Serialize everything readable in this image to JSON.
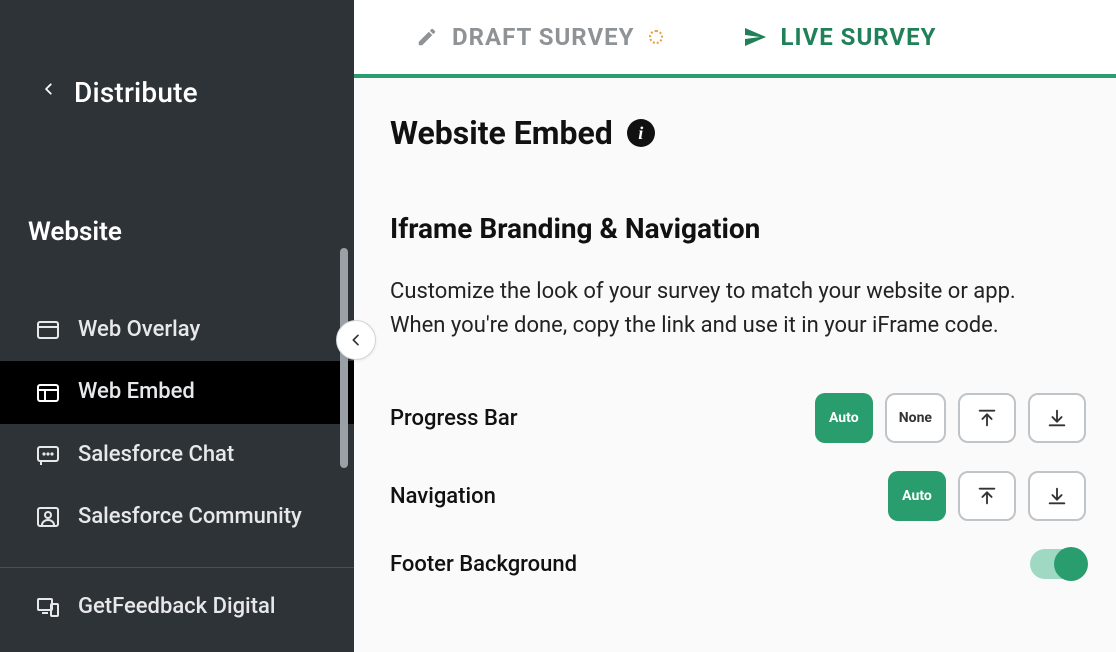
{
  "header": {
    "back_label": "Distribute"
  },
  "sidebar": {
    "section": "Website",
    "items": [
      {
        "label": "Web Overlay"
      },
      {
        "label": "Web Embed"
      },
      {
        "label": "Salesforce Chat"
      },
      {
        "label": "Salesforce Community"
      },
      {
        "label": "GetFeedback Digital"
      }
    ]
  },
  "tabs": {
    "draft": "DRAFT SURVEY",
    "live": "LIVE SURVEY"
  },
  "page": {
    "title": "Website Embed",
    "subsection": "Iframe Branding & Navigation",
    "description": "Customize the look of your survey to match your website or app. When you're done, copy the link and use it in your iFrame code."
  },
  "options": {
    "progress_bar": {
      "label": "Progress Bar",
      "auto": "Auto",
      "none": "None"
    },
    "navigation": {
      "label": "Navigation",
      "auto": "Auto"
    },
    "footer_bg": {
      "label": "Footer Background",
      "value": true
    }
  }
}
